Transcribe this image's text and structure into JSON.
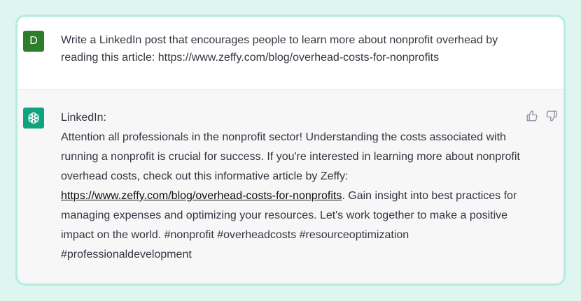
{
  "user": {
    "avatar_letter": "D",
    "message": "Write a LinkedIn post that encourages people to learn more about nonprofit overhead by reading this article: https://www.zeffy.com/blog/overhead-costs-for-nonprofits"
  },
  "assistant": {
    "avatar_icon": "openai-logo-icon",
    "heading": "LinkedIn:",
    "text_before_link": "Attention all professionals in the nonprofit sector! Understanding the costs associated with running a nonprofit is crucial for success. If you're interested in learning more about nonprofit overhead costs, check out this informative article by Zeffy: ",
    "link_text": "https://www.zeffy.com/blog/overhead-costs-for-nonprofits",
    "text_after_link": ". Gain insight into best practices for managing expenses and optimizing your resources. Let's work together to make a positive impact on the world. #nonprofit #overheadcosts #resourceoptimization #professionaldevelopment",
    "feedback_icons": [
      "thumbs-up-icon",
      "thumbs-down-icon"
    ]
  },
  "colors": {
    "page_bg": "#dff5ef",
    "frame_border": "#b4ece0",
    "user_avatar": "#2d7d2b",
    "assistant_avatar": "#10a37f",
    "assistant_bg": "#f7f7f8",
    "text": "#343541"
  }
}
